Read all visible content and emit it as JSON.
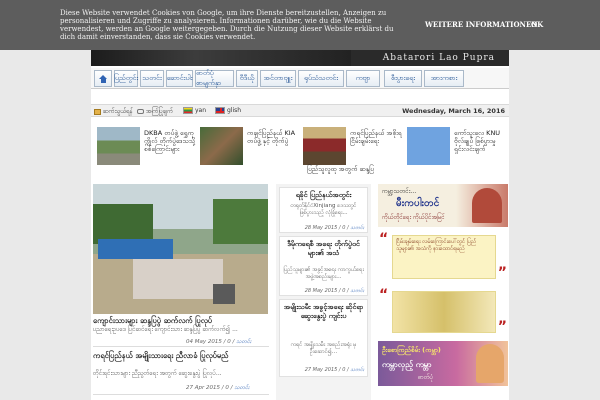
{
  "cookie": {
    "message": "Diese Website verwendet Cookies von Google, um ihre Dienste bereitzustellen, Anzeigen zu personalisieren und Zugriffe zu analysieren. Informationen darüber, wie du die Website verwendest, werden an Google weitergegeben. Durch die Nutzung dieser Website erklärst du dich damit einverstanden, dass sie Cookies verwendet.",
    "more_label": "WEITERE INFORMATIONEN",
    "ok_label": "OK"
  },
  "banner": {
    "title": "Abatarori Lao Pupra"
  },
  "nav": {
    "tabs": [
      "ပြည်တွင်း",
      "သတင်း",
      "ဆောင်းပါး",
      "ဓာတ်ပုံစာမျက်နှာ",
      "ဗီဒီယို",
      "အင်တာဗျူး",
      "ရုပ်သံသတင်း",
      "ကဗျာ",
      "စီးပွားရေး",
      "အားကစား"
    ]
  },
  "util": {
    "item1": "ဆက်သွယ်ရန်",
    "item2": "အကြံပြုချက်",
    "lang_mm": "yan",
    "lang_en": "glish",
    "date": "Wednesday, March 16, 2016"
  },
  "featured": [
    {
      "title": "DKBA တပ်ဖွဲ့ ရွှေကုက္ကိုလ် တိုက်ပွဲဒေသသို့ စစ်ကြောင်းများ"
    },
    {
      "title": "ကချင်ပြည်နယ် KIA တပ်ဖွဲ့ နှင့် တိုက်ပွဲ"
    },
    {
      "title": "ကရင်ပြည်နယ် အစိုးရ ငြိမ်းချမ်းရေး"
    },
    {
      "title": "ကော်သူးလေ KNU ဗိုလ်ချုပ် ဖြစ်ပွားမှု ရှင်းလင်းချက်"
    }
  ],
  "featured_extra": "ပြည်သူလူထု အတွက် ဆန္ဒပြ",
  "main_posts": [
    {
      "title": "ကျောင်းသားများ ဆန္ဒပြပွဲ ဆက်လက် ပြုလုပ်",
      "excerpt": "ပညာရေးဥပဒေ ပြင်ဆင်ရေး ကျောင်းသား ဆန္ဒပြပွဲ ဆက်လက်၍ ...",
      "date": "04 May 2015",
      "comments": "0",
      "category": "သတင်း"
    },
    {
      "title": "ကရင်ပြည်နယ် အမျိုးသားရေး ညီလာခံ ပြုလုပ်မည်",
      "excerpt": "တိုင်းရင်းသားများ ညီညွတ်ရေး အတွက် ဆွေးနွေးပွဲ ပြုလုပ်...",
      "date": "27 Apr 2015",
      "comments": "0",
      "category": "သတင်း"
    }
  ],
  "mid_posts": [
    {
      "title": "ရခိုင် ပြည်နယ်အတွင်း",
      "excerpt": "တရုတ်နိုင်ငံXinjiang ဒေသတွင် ဖြစ်ပွားသည့် လုံခြုံရေး...",
      "date": "28 May 2015",
      "comments": "0",
      "category": "သတင်း"
    },
    {
      "title": "ဒီမိုကရေစီ အရေး တိုက်ပွဲဝင်များ၏ အသံ",
      "excerpt": "ပြည်သူများ၏ အခွင့်အရေး ကာကွယ်ရေး အဖွဲ့အစည်းများ...",
      "date": "28 May 2015",
      "comments": "0",
      "category": "သတင်း"
    },
    {
      "title": "အမျိုးသမီး အခွင့်အရေး ဆိုင်ရာ ဆွေးနွေးပွဲ ကျင်းပ",
      "excerpt": "ကရင် အမျိုးသမီး အစည်းအရုံး မှ ဦးဆောင်၍...",
      "date": "27 May 2015",
      "comments": "0",
      "category": "သတင်း"
    }
  ],
  "right": {
    "banner1_top": "ကမ္ဘာ့သတင်း…",
    "banner1_main": "မီးကပါးတင်",
    "banner1_sub": "ကိုယ်တိုင်ရေး ကိုယ်ပိုင်အမြင်",
    "quote_text": "ငြိမ်းချမ်းရေး လမ်းကြောင်းပေါ်တွင် ပြည်သူများ၏ အသံကို နားထောင်ရမည်",
    "banner3_top": "ဦးစောကြည်စိမ်း (ကမ္ဘာ)",
    "banner3_main": "ကမ္ဘာလှည့် ကမ္ဘာ",
    "banner3_sub": "ဓာတ်ပုံ"
  }
}
